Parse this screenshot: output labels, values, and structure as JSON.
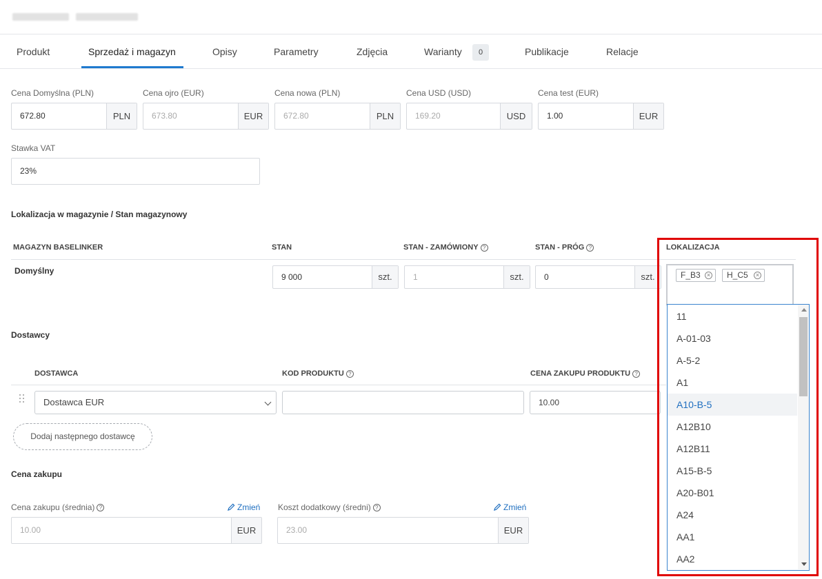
{
  "tabs": [
    {
      "label": "Produkt"
    },
    {
      "label": "Sprzedaż i magazyn"
    },
    {
      "label": "Opisy"
    },
    {
      "label": "Parametry"
    },
    {
      "label": "Zdjęcia"
    },
    {
      "label": "Warianty",
      "badge": "0"
    },
    {
      "label": "Publikacje"
    },
    {
      "label": "Relacje"
    }
  ],
  "prices": [
    {
      "label": "Cena Domyślna (PLN)",
      "value": "672.80",
      "unit": "PLN"
    },
    {
      "label": "Cena ojro (EUR)",
      "value": "673.80",
      "unit": "EUR"
    },
    {
      "label": "Cena nowa (PLN)",
      "value": "672.80",
      "unit": "PLN"
    },
    {
      "label": "Cena USD (USD)",
      "value": "169.20",
      "unit": "USD"
    },
    {
      "label": "Cena test (EUR)",
      "value": "1.00",
      "unit": "EUR"
    }
  ],
  "vat": {
    "label": "Stawka VAT",
    "value": "23%"
  },
  "warehouse": {
    "title": "Lokalizacja w magazynie / Stan magazynowy",
    "col_magazyn": "MAGAZYN BASELINKER",
    "col_stan": "STAN",
    "col_zamowiony": "STAN - ZAMÓWIONY",
    "col_prog": "STAN - PRÓG",
    "col_lokalizacja": "LOKALIZACJA",
    "row_name": "Domyślny",
    "stan": "9 000",
    "zamowiony": "1",
    "prog": "0",
    "unit": "szt.",
    "tags": [
      "F_B3",
      "H_C5"
    ]
  },
  "location_dropdown": {
    "options": [
      "11",
      "A-01-03",
      "A-5-2",
      "A1",
      "A10-B-5",
      "A12B10",
      "A12B11",
      "A15-B-5",
      "A20-B01",
      "A24",
      "AA1",
      "AA2"
    ],
    "highlighted": "A10-B-5"
  },
  "suppliers": {
    "title": "Dostawcy",
    "col_dostawca": "DOSTAWCA",
    "col_kod": "KOD PRODUKTU",
    "col_cena": "CENA ZAKUPU PRODUKTU",
    "supplier": "Dostawca EUR",
    "kod": "",
    "cena": "10.00",
    "add_button": "Dodaj następnego dostawcę"
  },
  "purchase": {
    "title": "Cena zakupu",
    "avg_label": "Cena zakupu (średnia)",
    "avg_value": "10.00",
    "avg_unit": "EUR",
    "extra_label": "Koszt dodatkowy (średni)",
    "extra_value": "23.00",
    "extra_unit": "EUR",
    "change_link": "Zmień"
  },
  "colors": {
    "accent": "#1f7acf",
    "highlight_frame": "#e00000",
    "dropdown_border": "#3a84cf"
  }
}
